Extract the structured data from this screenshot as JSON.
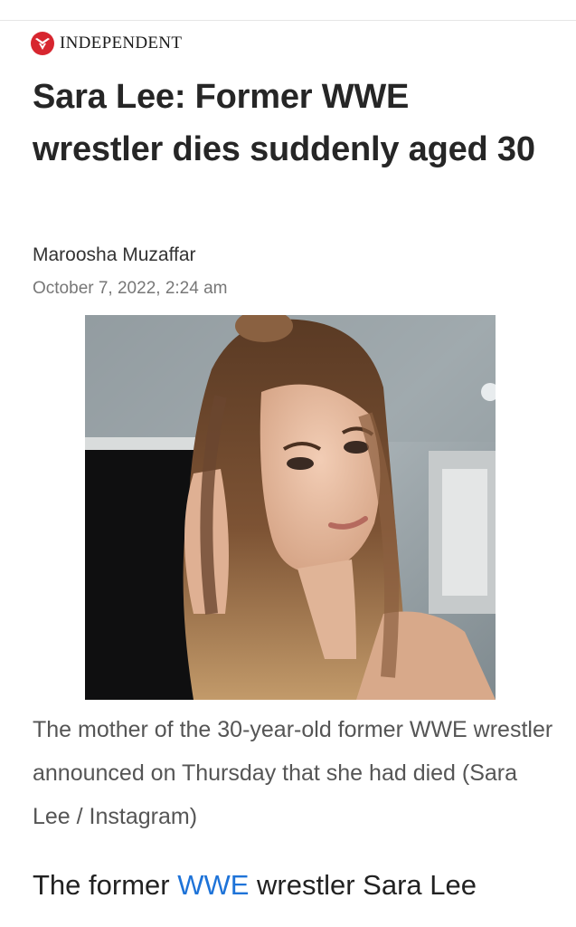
{
  "masthead": {
    "name": "INDEPENDENT",
    "logo_icon": "eagle-logo-icon",
    "brand_color": "#d7262f"
  },
  "article": {
    "headline": "Sara Lee: Former WWE wrestler dies suddenly aged 30",
    "author": "Maroosha Muzaffar",
    "date": "October 7, 2022, 2:24 am",
    "image_caption": "The mother of the 30-year-old former WWE wrestler announced on Thursday that she had died (Sara Lee / Instagram)",
    "body_start": {
      "before_link": "The former ",
      "link_text": "WWE",
      "after_link": " wrestler Sara Lee"
    },
    "link_color": "#1e73d8"
  }
}
